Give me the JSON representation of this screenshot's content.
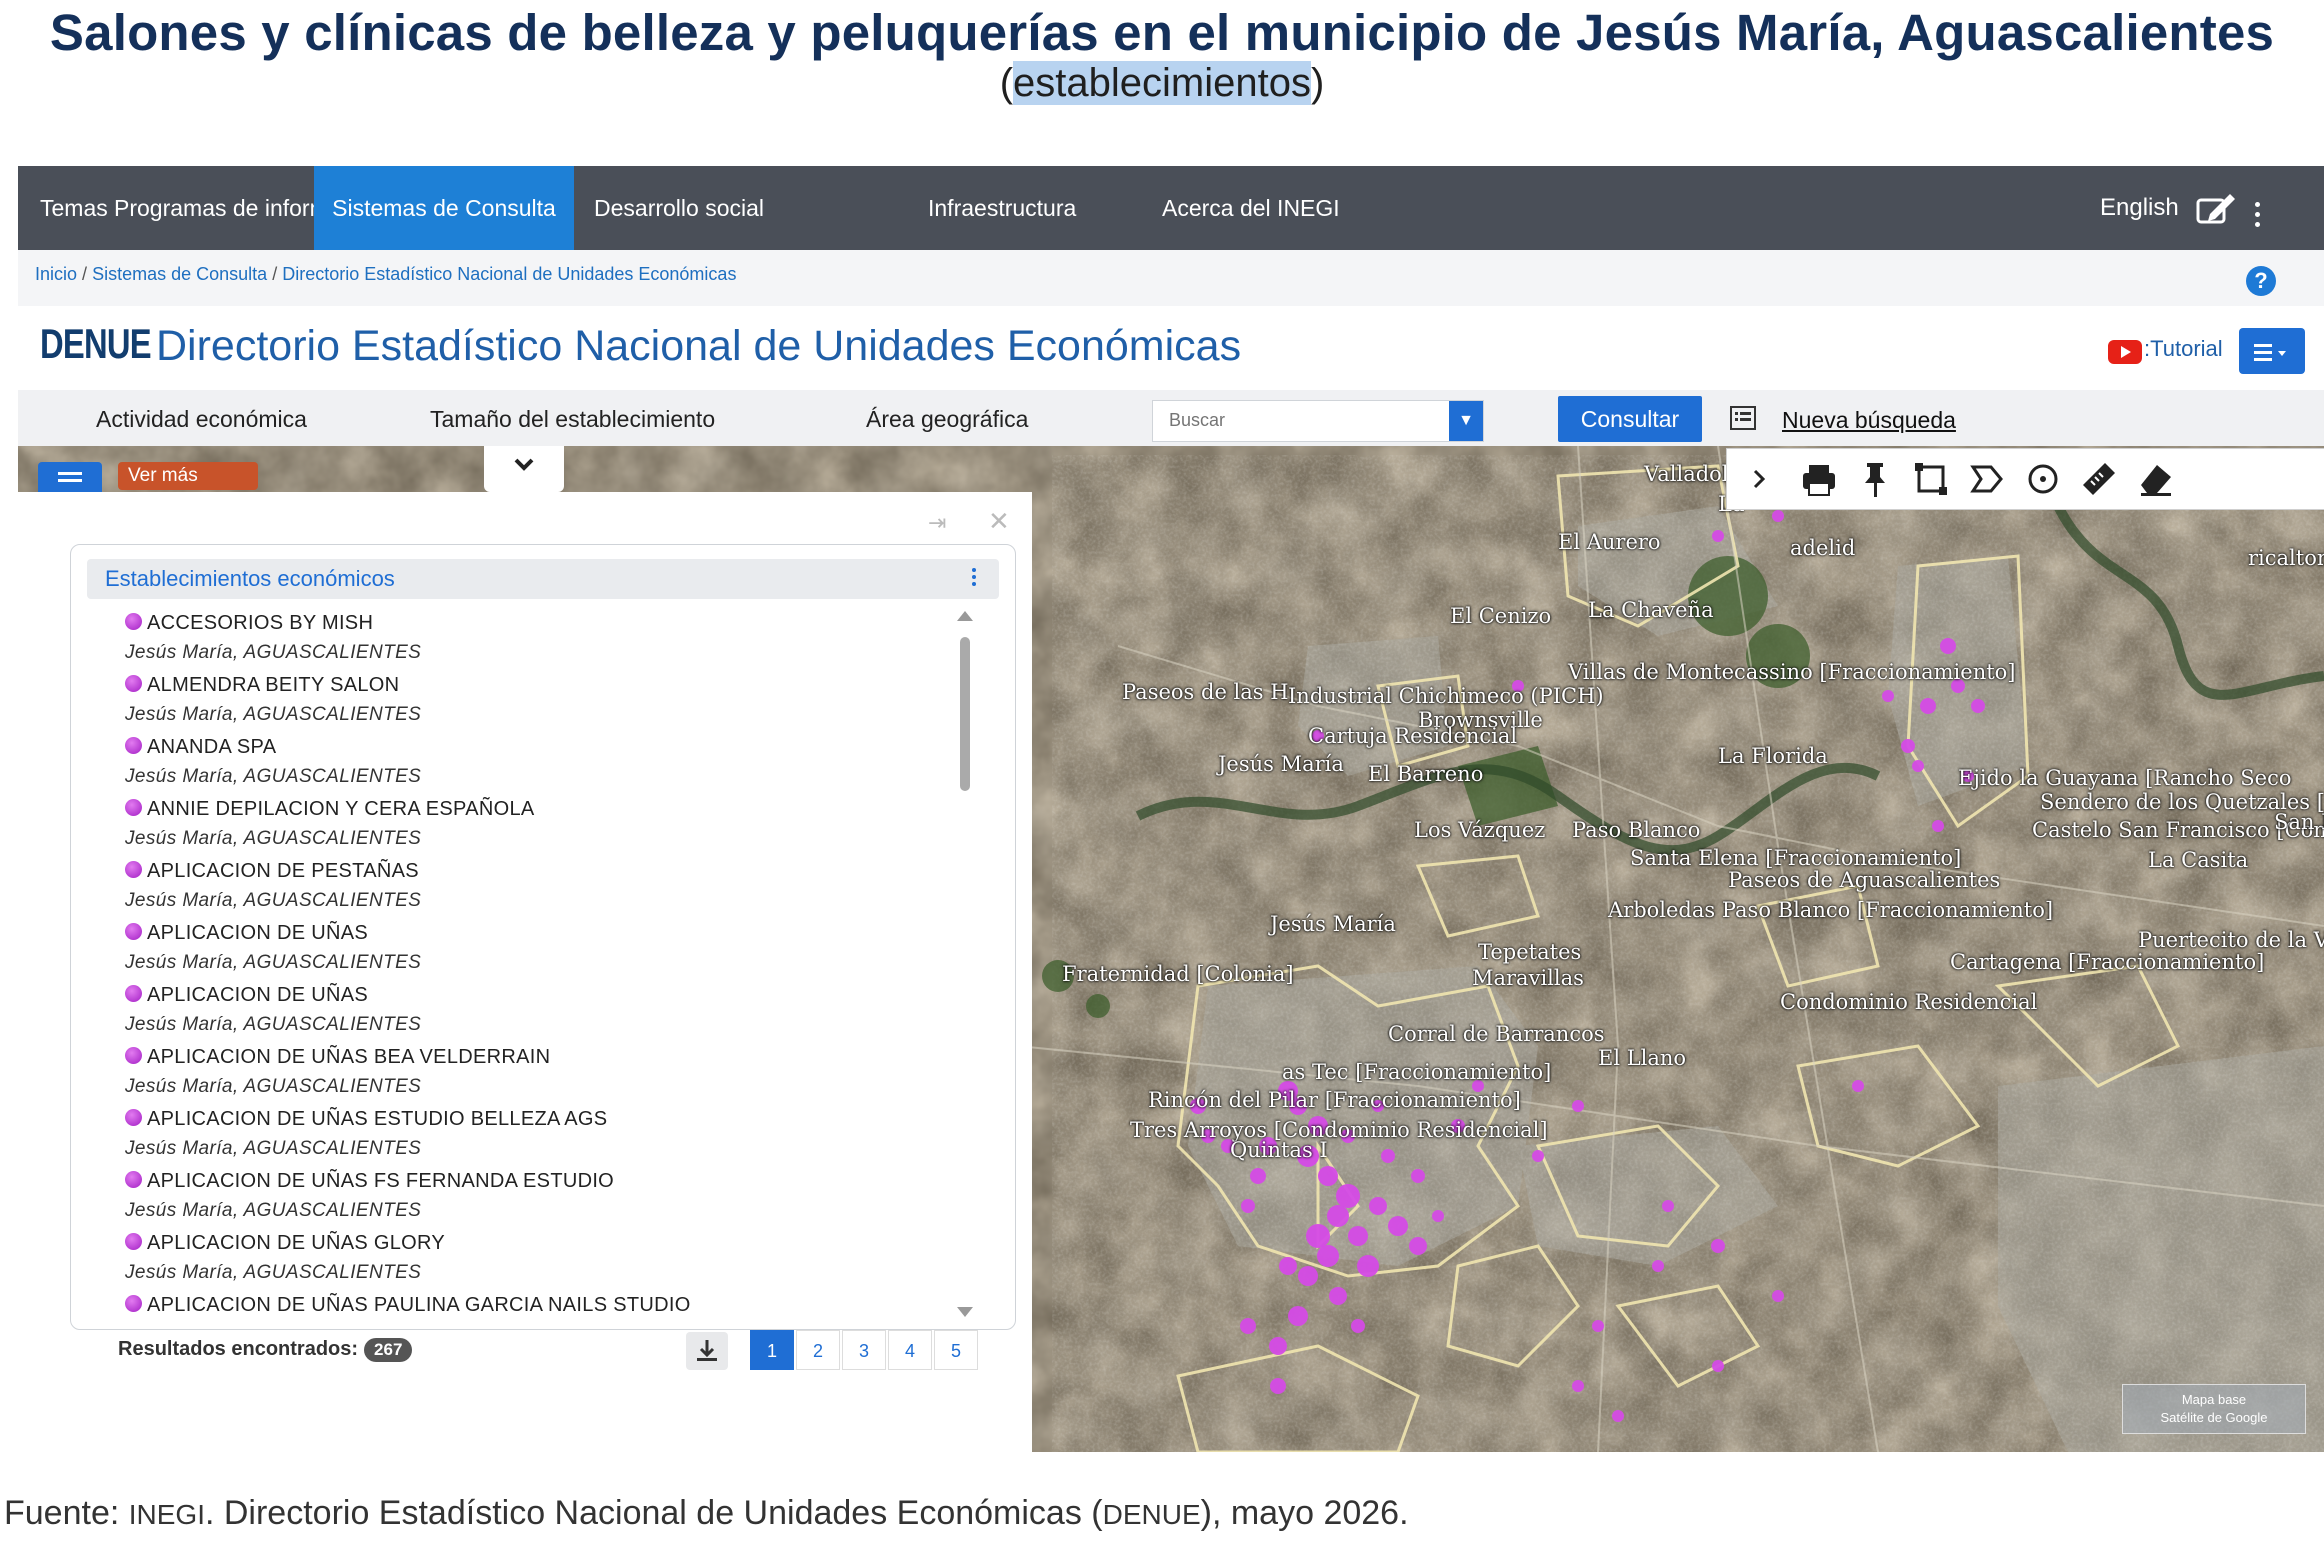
{
  "title": "Salones y clínicas de belleza y peluquerías en el municipio de Jesús María, Aguascalientes",
  "subtitle_open": "(",
  "subtitle_highlight": "establecimientos",
  "subtitle_close": ")",
  "nav": {
    "items": [
      "Temas",
      "Programas de información",
      "Sistemas de Consulta",
      "Desarrollo social",
      "Infraestructura",
      "Acerca del INEGI"
    ],
    "active_index": 2,
    "language": "English"
  },
  "breadcrumb": {
    "items": [
      "Inicio",
      "Sistemas de Consulta",
      "Directorio Estadístico Nacional de Unidades Económicas"
    ],
    "separator": "/"
  },
  "header": {
    "logo": "DENUE",
    "title": "Directorio Estadístico Nacional de Unidades Económicas",
    "tutorial": ":Tutorial"
  },
  "search": {
    "tabs": [
      "Actividad económica",
      "Tamaño del establecimiento",
      "Área geográfica"
    ],
    "placeholder": "Buscar",
    "submit": "Consultar",
    "new_search": "Nueva búsqueda"
  },
  "map_controls": {
    "ver_mas": "Ver más"
  },
  "panel": {
    "heading": "Establecimientos económicos",
    "results_label": "Resultados encontrados:",
    "results_count": "267",
    "pages": [
      "1",
      "2",
      "3",
      "4",
      "5"
    ],
    "current_page": "1",
    "items": [
      {
        "name": "ACCESORIOS BY MISH",
        "location": "Jesús María, AGUASCALIENTES"
      },
      {
        "name": "ALMENDRA BEITY SALON",
        "location": "Jesús María, AGUASCALIENTES"
      },
      {
        "name": "ANANDA SPA",
        "location": "Jesús María, AGUASCALIENTES"
      },
      {
        "name": "ANNIE DEPILACION Y CERA ESPAÑOLA",
        "location": "Jesús María, AGUASCALIENTES"
      },
      {
        "name": "APLICACION DE PESTAÑAS",
        "location": "Jesús María, AGUASCALIENTES"
      },
      {
        "name": "APLICACION DE UÑAS",
        "location": "Jesús María, AGUASCALIENTES"
      },
      {
        "name": "APLICACION DE UÑAS",
        "location": "Jesús María, AGUASCALIENTES"
      },
      {
        "name": "APLICACION DE UÑAS BEA VELDERRAIN",
        "location": "Jesús María, AGUASCALIENTES"
      },
      {
        "name": "APLICACION DE UÑAS ESTUDIO BELLEZA AGS",
        "location": "Jesús María, AGUASCALIENTES"
      },
      {
        "name": "APLICACION DE UÑAS FS FERNANDA ESTUDIO",
        "location": "Jesús María, AGUASCALIENTES"
      },
      {
        "name": "APLICACION DE UÑAS GLORY",
        "location": "Jesús María, AGUASCALIENTES"
      },
      {
        "name": "APLICACION DE UÑAS PAULINA GARCIA NAILS STUDIO",
        "location": ""
      }
    ]
  },
  "map_labels": [
    "Valladolid",
    "La",
    "El Aurero",
    "adelid",
    "ricalton",
    "El Cenizo",
    "La Chaveña",
    "Villas de Montecassino [Fraccionamiento]",
    "Paseos de las H",
    "Industrial Chichimeco (PICH)",
    "Brownsville",
    "Cartuja Residencial",
    "La Florida",
    "Jesús María",
    "El Barreno",
    "Ejido la Guayana [Rancho Seco",
    "Sendero de los Quetzales [Co",
    "Castelo San Francisco [Con",
    "San F",
    "Los Vázquez",
    "Paso Blanco",
    "Santa Elena [Fraccionamiento]",
    "La Casita",
    "Paseos de Aguascalientes",
    "Arboledas Paso Blanco [Fraccionamiento]",
    "Jesús María",
    "Tepetates",
    "Puertecito de la Virgen",
    "Fraternidad [Colonia]",
    "Maravillas",
    "Cartagena [Fraccionamiento]",
    "Condominio Residencial",
    "Corral de Barrancos",
    "El Llano",
    "as Tec [Fraccionamiento]",
    "Rincón del Pilar [Fraccionamiento]",
    "Tres Arroyos [Condominio Residencial]",
    "Quintas I"
  ],
  "basemap": {
    "line1": "Mapa base",
    "line2": "Satélite de Google"
  },
  "source": {
    "prefix": "Fuente: ",
    "org": "INEGI",
    "middle": ". Directorio Estadístico Nacional de Unidades Económicas (",
    "abbr": "DENUE",
    "suffix": "), mayo 2026."
  },
  "colors": {
    "nav_bg": "#4a4f58",
    "accent": "#1e80d6",
    "title": "#14305a",
    "marker": "#d54be6"
  }
}
